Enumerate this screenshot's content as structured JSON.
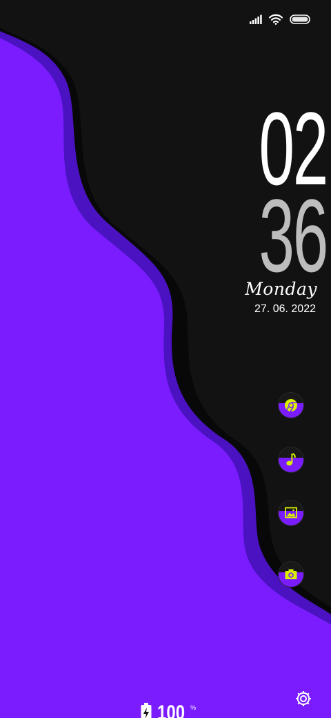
{
  "status_bar": {
    "signal_icon": "cellular-signal-icon",
    "wifi_icon": "wifi-icon",
    "battery_icon": "battery-pill-icon"
  },
  "clock": {
    "hour": "02",
    "minute": "36",
    "day": "Monday",
    "date": "27. 06. 2022"
  },
  "apps": [
    {
      "name": "browser",
      "icon": "chrome-icon"
    },
    {
      "name": "music",
      "icon": "music-note-icon"
    },
    {
      "name": "gallery",
      "icon": "image-icon"
    },
    {
      "name": "camera",
      "icon": "camera-icon"
    }
  ],
  "settings": {
    "icon": "gear-icon"
  },
  "battery": {
    "value": "100",
    "unit": "%",
    "icon": "battery-charging-icon"
  },
  "colors": {
    "background": "#121212",
    "purple": "#7b1cff",
    "purple_shadow": "#4410b8",
    "accent": "#d8f000",
    "minute_gray": "#bdbdbd"
  }
}
